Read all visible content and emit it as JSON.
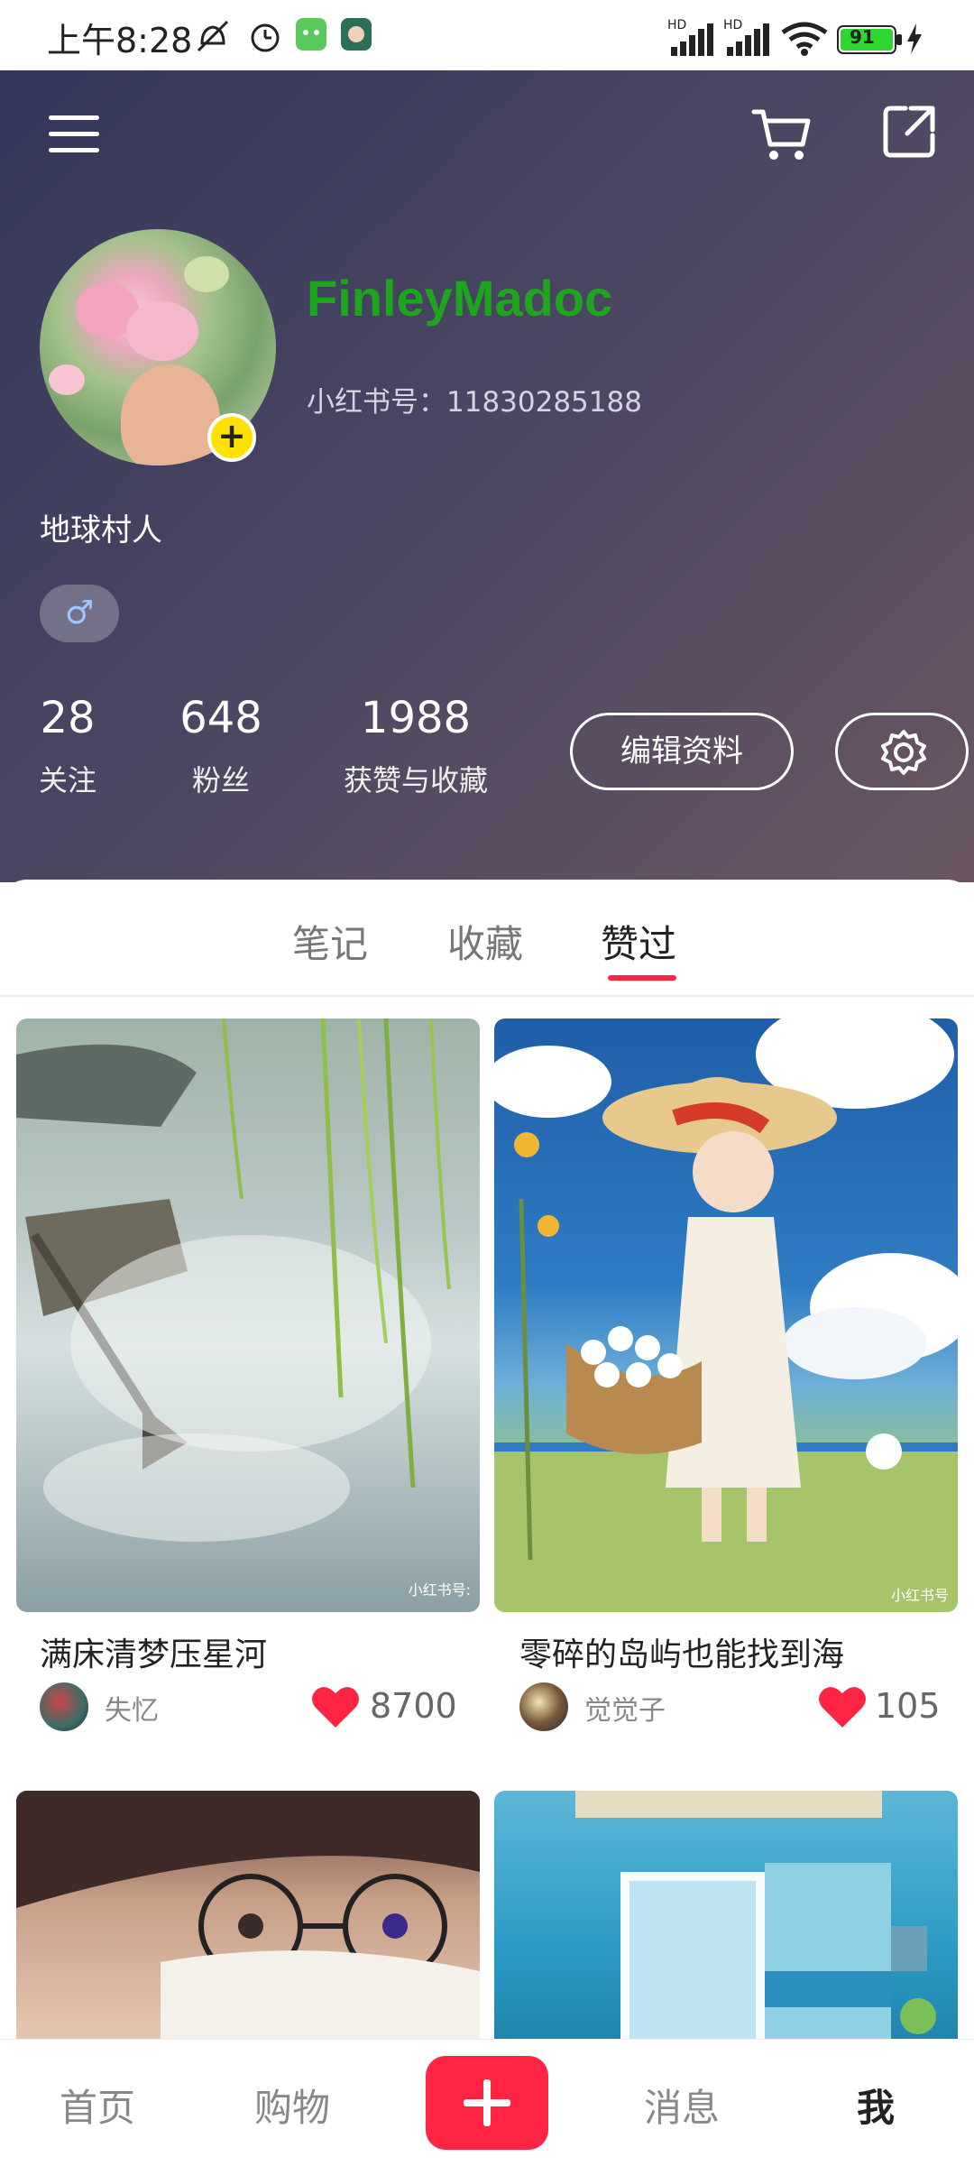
{
  "status_bar": {
    "time": "上午8:28",
    "battery": "91",
    "network_1": "HD",
    "network_2": "HD"
  },
  "header": {
    "menu_icon": "menu-icon",
    "cart_icon": "cart-icon",
    "share_icon": "share-icon"
  },
  "profile": {
    "username": "FinleyMadoc",
    "id_text": "小红书号：11830285188",
    "bio": "地球村人",
    "gender_symbol": "♂",
    "stats": [
      {
        "value": "28",
        "label": "关注"
      },
      {
        "value": "648",
        "label": "粉丝"
      },
      {
        "value": "1988",
        "label": "获赞与收藏"
      }
    ],
    "edit_label": "编辑资料"
  },
  "tabs": [
    {
      "label": "笔记"
    },
    {
      "label": "收藏"
    },
    {
      "label": "赞过"
    }
  ],
  "active_tab": "赞过",
  "cards": [
    {
      "title": "满床清梦压星河",
      "author": "失忆",
      "likes": "8700",
      "watermark": "小红书号:"
    },
    {
      "title": "零碎的岛屿也能找到海",
      "author": "觉觉子",
      "likes": "105",
      "watermark": "小红书号"
    }
  ],
  "bottom_nav": {
    "items": [
      {
        "label": "首页"
      },
      {
        "label": "购物"
      },
      {
        "label": "消息"
      },
      {
        "label": "我"
      }
    ],
    "plus_icon": "plus-icon"
  },
  "colors": {
    "accent": "#ff2442",
    "username": "#1ea51e",
    "badge": "#ffe100"
  }
}
